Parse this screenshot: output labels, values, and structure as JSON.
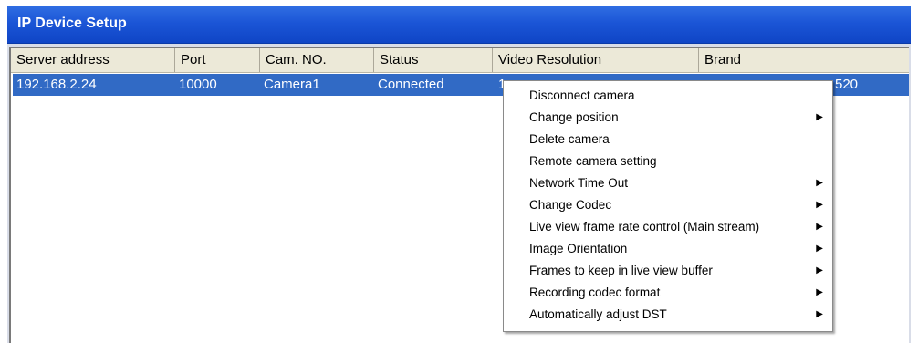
{
  "window": {
    "title": "IP Device Setup"
  },
  "table": {
    "columns": [
      "Server address",
      "Port",
      "Cam. NO.",
      "Status",
      "Video Resolution",
      "Brand"
    ],
    "rows": [
      {
        "server_address": "192.168.2.24",
        "port": "10000",
        "cam_no": "Camera1",
        "status": "Connected",
        "video_resolution_fragment": "1",
        "brand_fragment": "520"
      }
    ]
  },
  "context_menu": {
    "items": [
      {
        "label": "Disconnect camera",
        "submenu": false
      },
      {
        "label": "Change position",
        "submenu": true
      },
      {
        "label": "Delete camera",
        "submenu": false
      },
      {
        "label": "Remote camera setting",
        "submenu": false
      },
      {
        "label": "Network Time Out",
        "submenu": true
      },
      {
        "label": "Change Codec",
        "submenu": true
      },
      {
        "label": "Live view frame rate control (Main stream)",
        "submenu": true
      },
      {
        "label": "Image Orientation",
        "submenu": true
      },
      {
        "label": "Frames to keep in live view buffer",
        "submenu": true
      },
      {
        "label": "Recording codec format",
        "submenu": true
      },
      {
        "label": "Automatically adjust DST",
        "submenu": true
      }
    ],
    "submenu_glyph": "▶"
  },
  "colors": {
    "titlebar": "#1b55d6",
    "selection": "#316ac5",
    "header_bg": "#ece9d8"
  }
}
